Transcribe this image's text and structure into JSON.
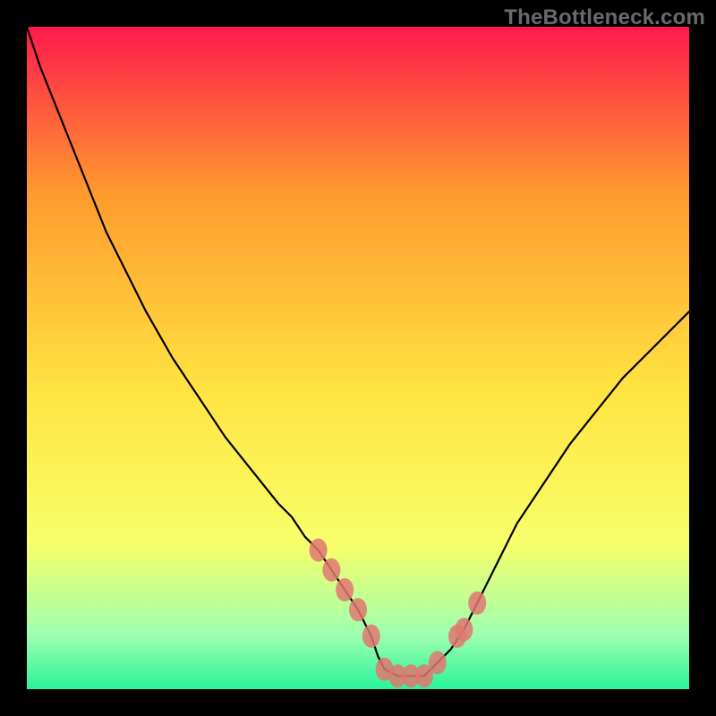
{
  "watermark": "TheBottleneck.com",
  "colors": {
    "bg": "#000000",
    "grad_top": "#ff1a4d",
    "grad_mid1": "#ff9a2e",
    "grad_mid2": "#ffe441",
    "grad_low1": "#f8ff6a",
    "grad_low2": "#9cffb0",
    "grad_bottom": "#29f39a",
    "curve": "#000000",
    "marker": "#e07770"
  },
  "chart_data": {
    "type": "line",
    "title": "",
    "xlabel": "",
    "ylabel": "",
    "xlim": [
      0,
      100
    ],
    "ylim": [
      0,
      100
    ],
    "grid": false,
    "series": [
      {
        "name": "curve",
        "x": [
          0,
          1,
          2,
          4,
          6,
          8,
          10,
          12,
          15,
          18,
          22,
          26,
          30,
          34,
          38,
          40,
          42,
          44,
          46,
          48,
          50,
          52,
          53,
          54,
          56,
          58,
          60,
          62,
          64,
          66,
          68,
          70,
          72,
          74,
          78,
          82,
          86,
          90,
          94,
          98,
          100
        ],
        "y": [
          100,
          97,
          94,
          89,
          84,
          79,
          74,
          69,
          63,
          57,
          50,
          44,
          38,
          33,
          28,
          26,
          23,
          21,
          18,
          15,
          12,
          8,
          5,
          3,
          2,
          2,
          2,
          4,
          6,
          9,
          13,
          17,
          21,
          25,
          31,
          37,
          42,
          47,
          51,
          55,
          57
        ]
      }
    ],
    "markers": {
      "name": "dots",
      "x": [
        44,
        46,
        48,
        50,
        52,
        54,
        56,
        58,
        60,
        62,
        65,
        66,
        68
      ],
      "y": [
        21,
        18,
        15,
        12,
        8,
        3,
        2,
        2,
        2,
        4,
        8,
        9,
        13
      ]
    }
  }
}
